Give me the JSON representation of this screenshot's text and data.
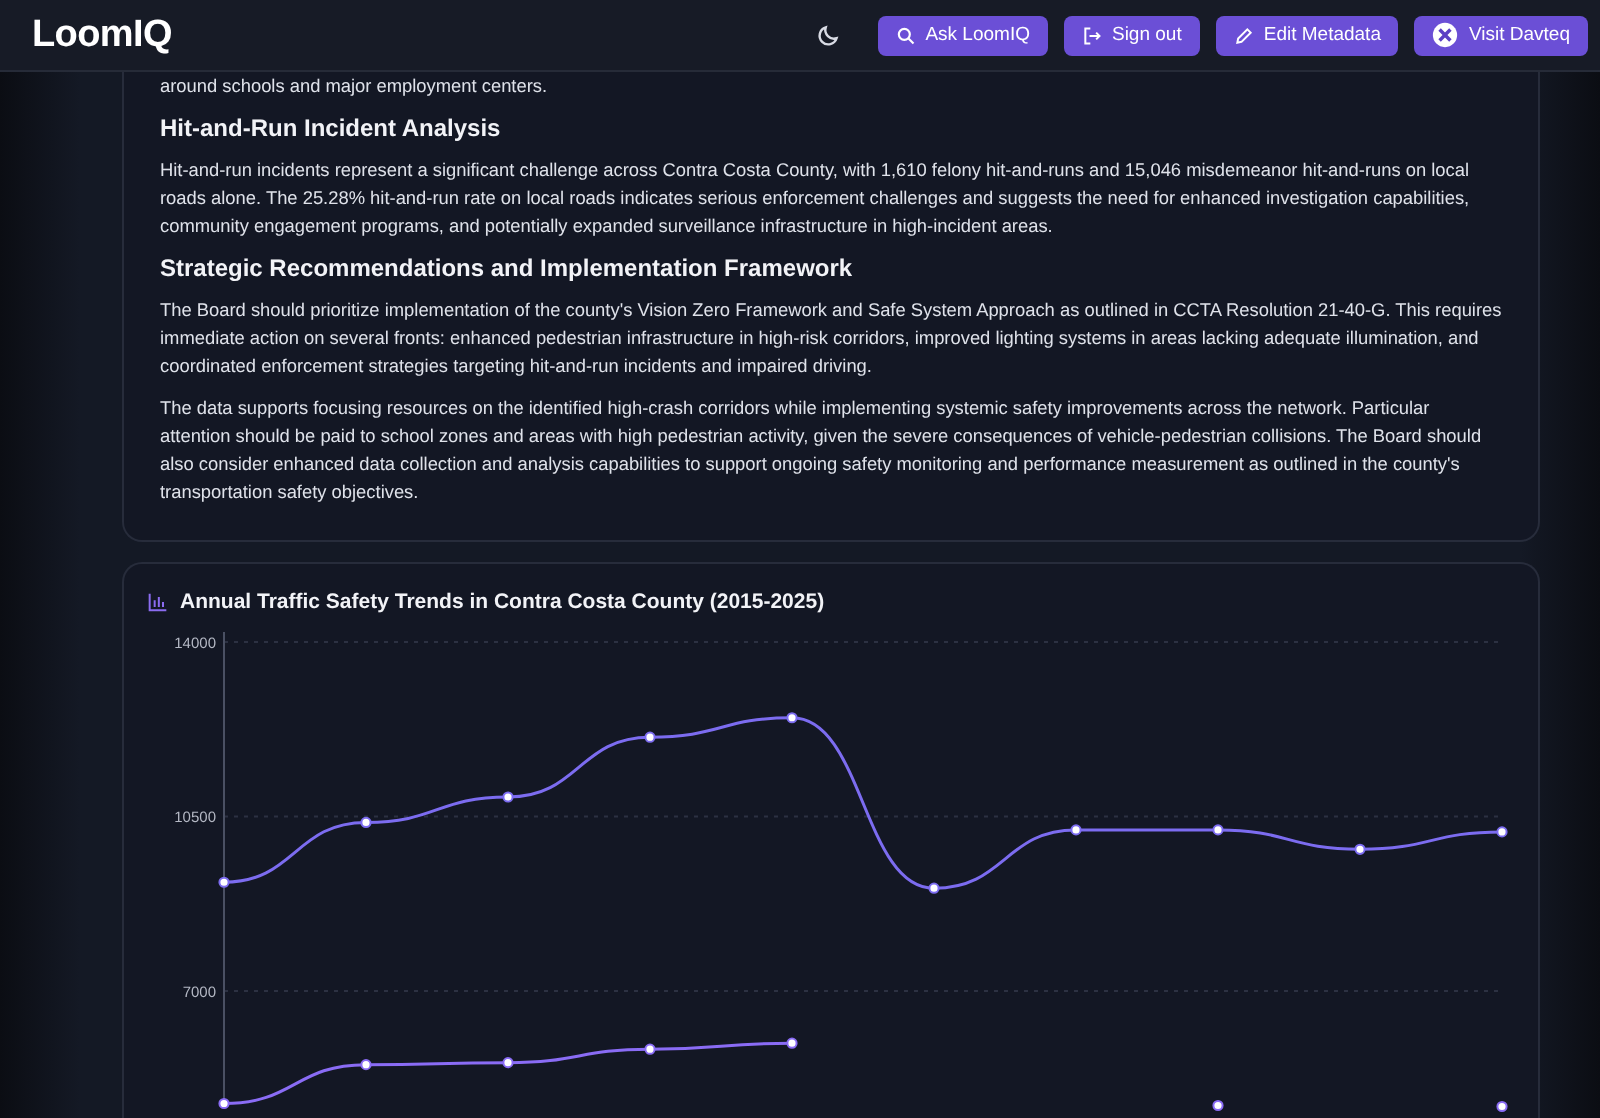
{
  "header": {
    "logo": "LoomIQ",
    "theme_toggle": {
      "kind": "moon"
    },
    "buttons": [
      {
        "label": "Ask LoomIQ"
      },
      {
        "label": "Sign out"
      },
      {
        "label": "Edit Metadata"
      },
      {
        "label": "Visit Davteq"
      }
    ]
  },
  "report": {
    "blocks": [
      {
        "kind": "paragraph",
        "text": "around schools and major employment centers."
      },
      {
        "kind": "heading",
        "text": "Hit-and-Run Incident Analysis"
      },
      {
        "kind": "paragraph",
        "text": "Hit-and-run incidents represent a significant challenge across Contra Costa County, with 1,610 felony hit-and-runs and 15,046 misdemeanor hit-and-runs on local roads alone. The 25.28% hit-and-run rate on local roads indicates serious enforcement challenges and suggests the need for enhanced investigation capabilities, community engagement programs, and potentially expanded surveillance infrastructure in high-incident areas."
      },
      {
        "kind": "heading",
        "text": "Strategic Recommendations and Implementation Framework"
      },
      {
        "kind": "paragraph",
        "text": "The Board should prioritize implementation of the county's Vision Zero Framework and Safe System Approach as outlined in CCTA Resolution 21-40-G. This requires immediate action on several fronts: enhanced pedestrian infrastructure in high-risk corridors, improved lighting systems in areas lacking adequate illumination, and coordinated enforcement strategies targeting hit-and-run incidents and impaired driving."
      },
      {
        "kind": "paragraph",
        "text": "The data supports focusing resources on the identified high-crash corridors while implementing systemic safety improvements across the network. Particular attention should be paid to school zones and areas with high pedestrian activity, given the severe consequences of vehicle-pedestrian collisions. The Board should also consider enhanced data collection and analysis capabilities to support ongoing safety monitoring and performance measurement as outlined in the county's transportation safety objectives."
      }
    ]
  },
  "chart_card": {
    "title": "Annual Traffic Safety Trends in Contra Costa County (2015-2025)",
    "chart_data": {
      "type": "line",
      "ylim": [
        4650,
        14000
      ],
      "yticks": [
        7000,
        10500,
        14000
      ],
      "series": [
        {
          "color": "#7c6cf0",
          "marker": "circle",
          "values": [
            9180,
            10380,
            10890,
            12090,
            12480,
            9060,
            10230,
            10230,
            9840,
            10190
          ]
        },
        {
          "color": "#8a6cf5",
          "marker": "circle",
          "values": [
            4740,
            5520,
            5560,
            5830,
            5950,
            null,
            null,
            4700,
            null,
            4680
          ]
        }
      ]
    }
  }
}
